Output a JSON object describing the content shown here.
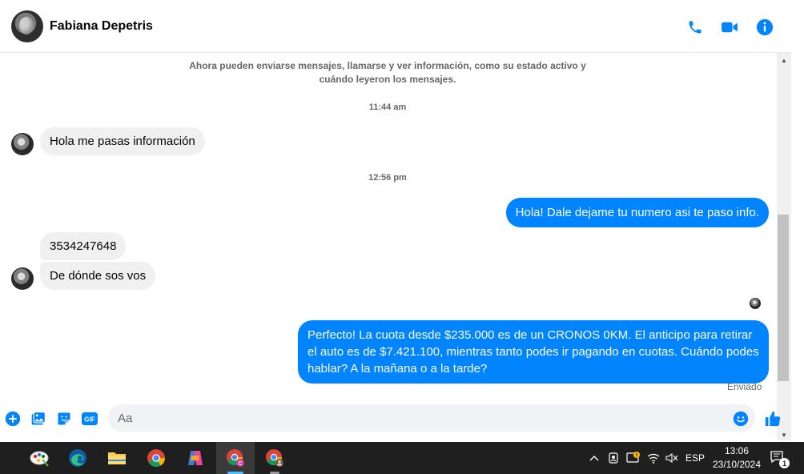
{
  "header": {
    "contact_name": "Fabiana Depetris"
  },
  "chat": {
    "system_message": "Ahora pueden enviarse mensajes, llamarse y ver información, como su estado activo y cuándo leyeron los mensajes.",
    "time_1": "11:44 am",
    "msg_in_1": "Hola me pasas información",
    "time_2": "12:56 pm",
    "msg_out_1": "Hola! Dale dejame tu numero  asi te paso info.",
    "msg_in_2": "3534247648",
    "msg_in_3": "De dónde sos vos",
    "msg_out_2": "Perfecto! La cuota desde $235.000 es de un CRONOS 0KM. El anticipo para retirar el auto es de $7.421.100, mientras tanto podes ir pagando en cuotas. Cuándo podes hablar? A la mañana o a la tarde?",
    "sent_status": "Enviado"
  },
  "composer": {
    "placeholder": "Aa"
  },
  "taskbar": {
    "language": "ESP",
    "time": "13:06",
    "date": "23/10/2024",
    "notification_count": "1"
  },
  "colors": {
    "messenger_blue": "#0084ff",
    "incoming_bubble": "#f0f0f0",
    "taskbar_bg": "#1f1f1f"
  }
}
